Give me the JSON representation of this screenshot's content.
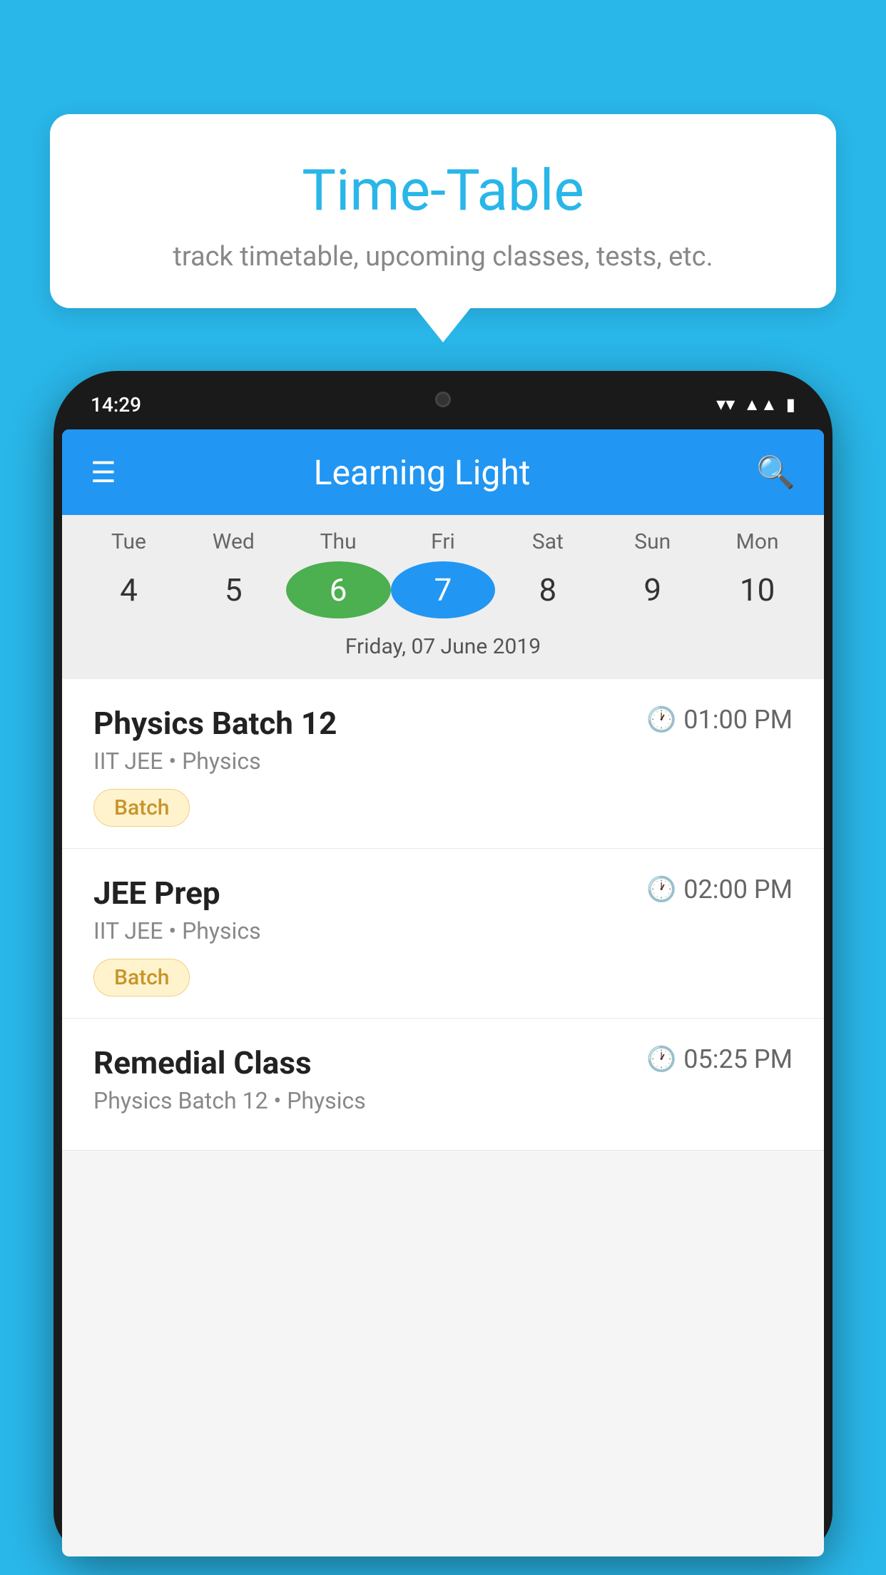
{
  "background_color": "#29b6e8",
  "tooltip": {
    "title": "Time-Table",
    "subtitle": "track timetable, upcoming classes, tests, etc."
  },
  "phone": {
    "status_bar": {
      "time": "14:29"
    },
    "app_header": {
      "title": "Learning Light"
    },
    "calendar": {
      "days": [
        {
          "label": "Tue",
          "number": "4"
        },
        {
          "label": "Wed",
          "number": "5"
        },
        {
          "label": "Thu",
          "number": "6",
          "state": "today"
        },
        {
          "label": "Fri",
          "number": "7",
          "state": "selected"
        },
        {
          "label": "Sat",
          "number": "8"
        },
        {
          "label": "Sun",
          "number": "9"
        },
        {
          "label": "Mon",
          "number": "10"
        }
      ],
      "selected_date_label": "Friday, 07 June 2019"
    },
    "schedule": [
      {
        "title": "Physics Batch 12",
        "time": "01:00 PM",
        "subtitle": "IIT JEE • Physics",
        "badge": "Batch"
      },
      {
        "title": "JEE Prep",
        "time": "02:00 PM",
        "subtitle": "IIT JEE • Physics",
        "badge": "Batch"
      },
      {
        "title": "Remedial Class",
        "time": "05:25 PM",
        "subtitle": "Physics Batch 12 • Physics",
        "badge": null
      }
    ]
  },
  "icons": {
    "hamburger": "≡",
    "search": "🔍",
    "clock": "🕐"
  }
}
